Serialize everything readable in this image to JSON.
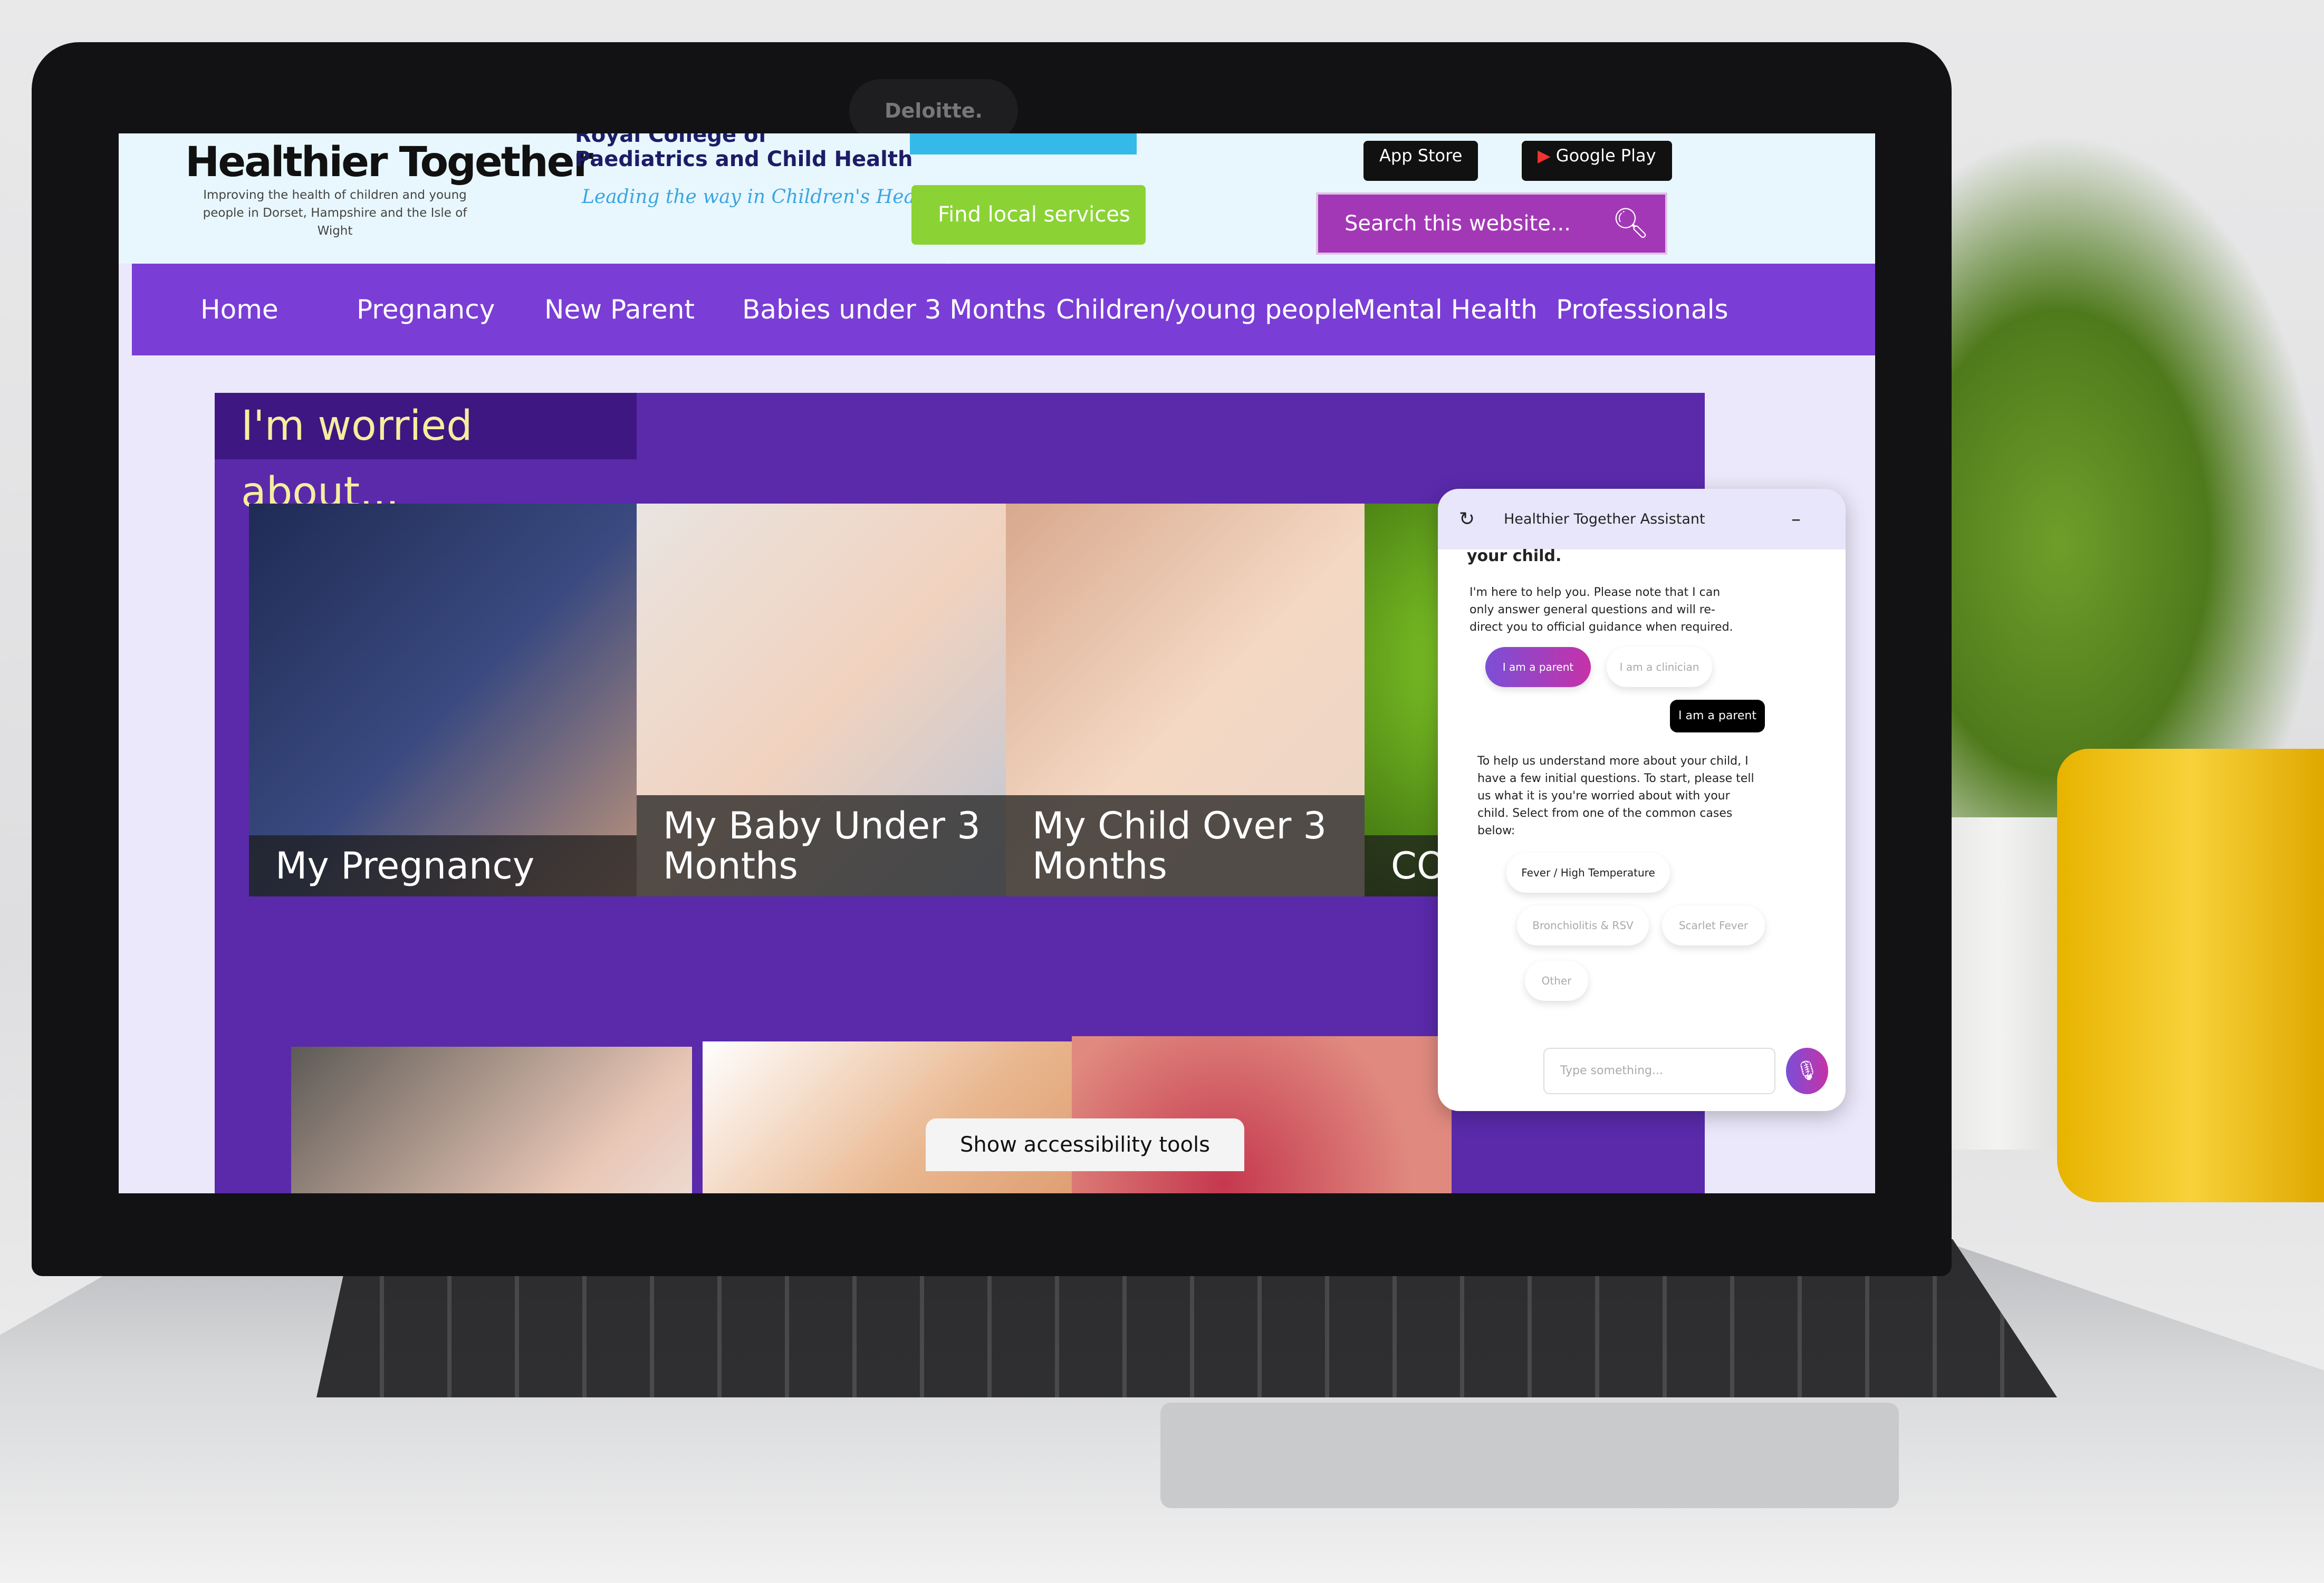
{
  "laptop": {
    "camera_brand": "Deloitte."
  },
  "header": {
    "logo_title": "Healthier Together",
    "logo_subtitle": "Improving the health of children and young people in Dorset, Hampshire and the Isle of Wight",
    "partner_name_line1": "Royal College of",
    "partner_name_line2": "Paediatrics and Child Health",
    "partner_tagline": "Leading the way in Children's Health",
    "find_services_label": "Find local services",
    "app_store_label": "App Store",
    "google_play_label": "Google Play",
    "search_placeholder": "Search this website..."
  },
  "nav": {
    "items": [
      "Home",
      "Pregnancy",
      "New Parent",
      "Babies under 3 Months",
      "Children/young people",
      "Mental Health",
      "Professionals"
    ]
  },
  "main": {
    "section_title": "I'm worried about...",
    "tiles": [
      "My Pregnancy",
      "My Baby Under 3 Months",
      "My Child Over 3 Months",
      "COVID"
    ],
    "accessibility_label": "Show accessibility tools"
  },
  "chat": {
    "title": "Healthier Together Assistant",
    "partial_heading": "your child.",
    "intro": "I'm here to help you. Please note that I can only answer general questions and will re-direct you to official guidance when required.",
    "role_options": [
      "I am a parent",
      "I am a clinician"
    ],
    "user_reply": "I am a parent",
    "bot_message": "To help us understand more about your child, I have a few initial questions. To start, please tell us what it is you're worried about with your child. Select from one of the common cases below:",
    "case_options": [
      "Fever / High Temperature",
      "Bronchiolitis & RSV",
      "Scarlet Fever",
      "Other"
    ],
    "input_placeholder": "Type something...",
    "accent_gradient": [
      "#7b4fd6",
      "#c532a8"
    ]
  },
  "colors": {
    "nav": "#7a3ed6",
    "panel": "#5a2aab",
    "find_button": "#8bd334",
    "search": "#a338b6"
  }
}
